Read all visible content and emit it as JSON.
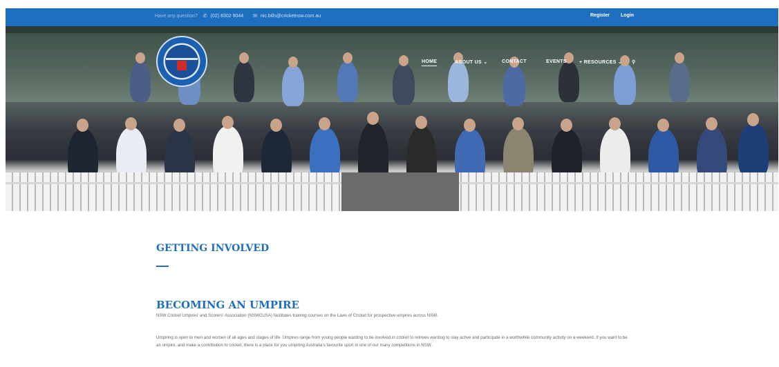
{
  "topbar": {
    "question": "Have any question?",
    "phone": "(02) 8302 9044",
    "email": "nic.bills@cricketnsw.com.au",
    "register": "Register",
    "login": "Login"
  },
  "nav": {
    "items": [
      {
        "label": "HOME"
      },
      {
        "label": "ABOUT US ⌄"
      },
      {
        "label": "CONTACT"
      },
      {
        "label": "EVENTS"
      },
      {
        "label": "+ RESOURCES ⌄"
      }
    ]
  },
  "content": {
    "heading": "GETTING INVOLVED",
    "subheading": "BECOMING AN UMPIRE",
    "para1": "NSW Cricket Umpires' and Scorers' Association (NSWCUSA) facilitates training courses on the Laws of Cricket for prospective umpires across NSW.",
    "para2": "Umpiring is open to men and women of all ages and stages of life. Umpires range from young people wanting to be involved in cricket to retirees wanting to stay active and participate in a worthwhile community activity on a weekend. If you want to be an umpire, and make a contribution to cricket, there is a place for you umpiring Australia's favourite sport in one of our many competitions in NSW."
  },
  "colors": {
    "brand_blue": "#1e6fc0"
  }
}
